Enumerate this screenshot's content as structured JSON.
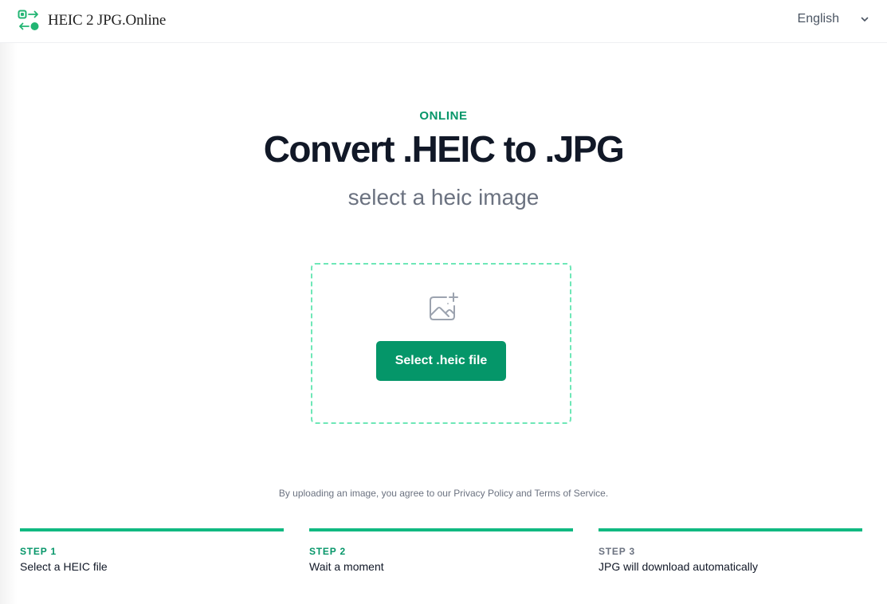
{
  "header": {
    "logo_text": "HEIC 2 JPG.Online",
    "language": "English"
  },
  "hero": {
    "eyebrow": "ONLINE",
    "title": "Convert .HEIC to .JPG",
    "subtitle": "select a heic image"
  },
  "dropzone": {
    "icon": "image-add-icon",
    "button_label": "Select .heic file"
  },
  "legal": {
    "prefix": "By uploading an image, you agree to our ",
    "privacy_link": "Privacy Policy",
    "and": " and ",
    "terms_link": "Terms of Service",
    "suffix": "."
  },
  "steps": [
    {
      "label": "STEP 1",
      "description": "Select a HEIC file"
    },
    {
      "label": "STEP 2",
      "description": "Wait a moment"
    },
    {
      "label": "STEP 3",
      "description": "JPG will download automatically"
    }
  ],
  "colors": {
    "accent": "#059669",
    "accent_bar": "#10b981",
    "dashed_border": "#6ee7b7"
  }
}
